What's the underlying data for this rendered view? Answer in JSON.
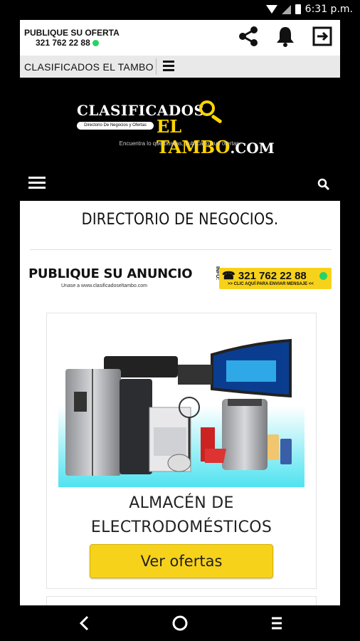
{
  "status_bar": {
    "time": "6:31 p.m."
  },
  "top_bar": {
    "publish_label": "PUBLIQUE SU OFERTA",
    "publish_phone": "321 762 22 88"
  },
  "nav": {
    "title": "CLASIFICADOS EL TAMBO"
  },
  "logo": {
    "line1": "CLASIFICADOS",
    "pill": "Directorio De Negocios y Ofertas",
    "line2": "EL TAMBO",
    "line2_suffix": ".COM",
    "tagline": "Encuentra lo que buscas, publica lo que ofertas."
  },
  "main": {
    "directory_title": "DIRECTORIO DE NEGOCIOS.",
    "banner": {
      "headline": "PUBLIQUE SU ANUNCIO",
      "subtext": "Unase a www.clasificadoseltambo.com",
      "info_label": "INFO:",
      "phone": "☎ 321 762 22 88",
      "cta": ">> CLIC AQUÍ PARA ENVIAR MENSAJE <<"
    },
    "card": {
      "title_line1": "ALMACÉN DE",
      "title_line2": "ELECTRODOMÉSTICOS",
      "button_label": "Ver ofertas"
    }
  },
  "colors": {
    "accent_yellow": "#f7d21a",
    "whatsapp_green": "#25d366",
    "background": "#000000"
  }
}
